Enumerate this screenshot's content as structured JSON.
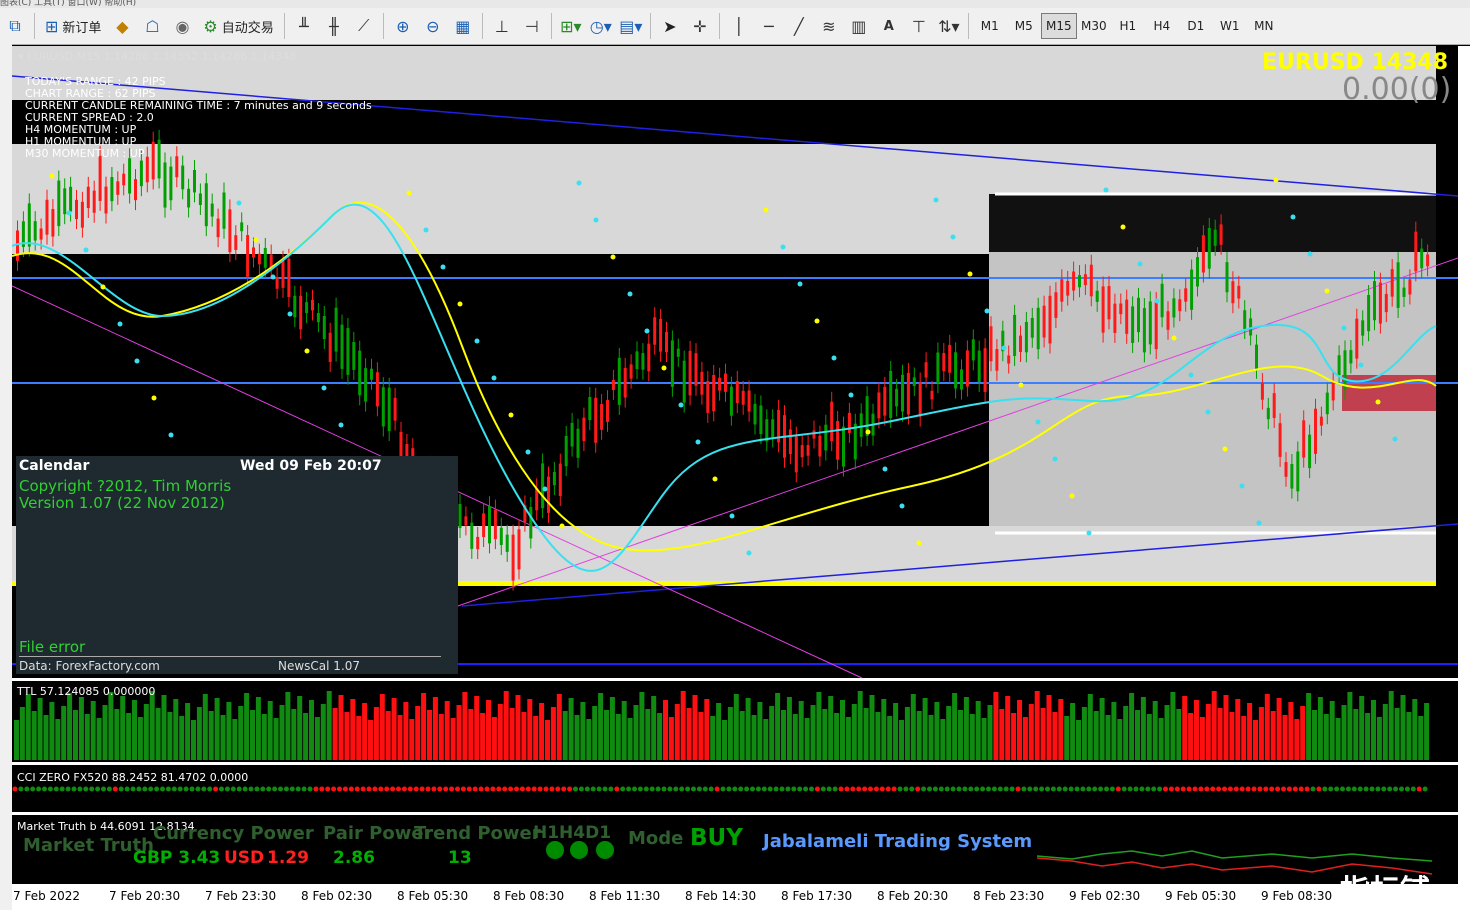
{
  "menu": {
    "text": "图表(C)  工具(T)  窗口(W)  帮助(H)"
  },
  "toolbar": {
    "new_order_label": "新订单",
    "auto_trade_label": "自动交易",
    "text_tool_label": "A",
    "timeframes": [
      "M1",
      "M5",
      "M15",
      "M30",
      "H1",
      "H4",
      "D1",
      "W1",
      "MN"
    ],
    "active_timeframe": "M15"
  },
  "chart": {
    "symbol_header": "EURUSD,M15  1.14286 1.14352 1.14286 1.14348",
    "info_lines": [
      "TODAY'S RANGE : 42 PIPS",
      "CHART RANGE : 62 PIPS",
      "CURRENT CANDLE REMAINING TIME : 7 minutes and 9 seconds",
      "CURRENT SPREAD : 2.0",
      "H4 MOMENTUM : UP",
      "H1 MOMENTUM : UP",
      "M30 MOMENTUM : UP"
    ],
    "price_big": "EURUSD  14348",
    "price_sub": "0.00(0)"
  },
  "calendar": {
    "title": "Calendar",
    "datetime": "Wed 09 Feb 20:07",
    "copyright": "Copyright ?2012, Tim Morris",
    "version": "Version 1.07 (22 Nov 2012)",
    "error": "File error",
    "source": "Data: ForexFactory.com",
    "newscal": "NewsCal 1.07"
  },
  "ttl": {
    "label": "TTL 57.124085 0.000000"
  },
  "cci": {
    "label": "CCI ZERO FX520 88.2452 81.4702 0.0000"
  },
  "market_truth": {
    "label": "Market Truth b 44.6091 12.8134",
    "currency_power_title": "Currency Power",
    "market_truth_title": "Market Truth",
    "gbp_label": "GBP 3.43",
    "usd_label": "USD",
    "usd_value": "1.29",
    "pair_power_title": "Pair Power",
    "pair_power_value": "2.86",
    "trend_power_title": "Trend Power",
    "trend_power_value": "13",
    "h1h4d1_label": "H1H4D1",
    "mode_label": "Mode",
    "mode_value": "BUY",
    "system_name": "Jabalameli Trading System"
  },
  "time_axis": [
    "7 Feb 2022",
    "7 Feb 20:30",
    "7 Feb 23:30",
    "8 Feb 02:30",
    "8 Feb 05:30",
    "8 Feb 08:30",
    "8 Feb 11:30",
    "8 Feb 14:30",
    "8 Feb 17:30",
    "8 Feb 20:30",
    "8 Feb 23:30",
    "9 Feb 02:30",
    "9 Feb 05:30",
    "9 Feb 08:30"
  ],
  "watermark": "指标铺",
  "colors": {
    "bull": "#00a000",
    "bear": "#ff1a1a",
    "ma_yellow": "#ffff00",
    "ma_cyan": "#38e0f0",
    "trend_magenta": "#e040e0",
    "trend_blue": "#2020e0",
    "hline": "#3a7fff"
  }
}
